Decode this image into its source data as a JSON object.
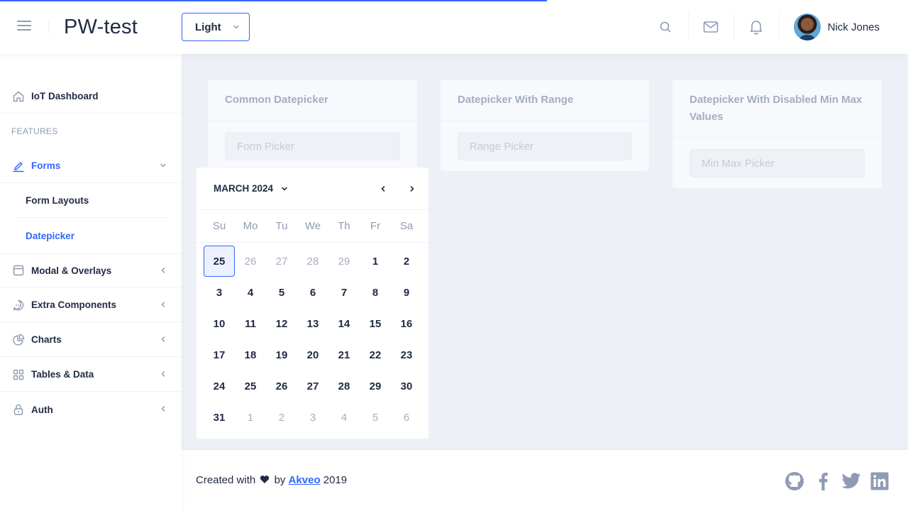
{
  "header": {
    "logo": "PW-test",
    "theme": {
      "selected": "Light"
    },
    "user": {
      "name": "Nick Jones"
    }
  },
  "sidebar": {
    "items": [
      {
        "label": "IoT Dashboard",
        "icon": "home-icon"
      },
      {
        "label": "Forms",
        "icon": "edit-icon",
        "expanded": true
      },
      {
        "label": "Modal & Overlays",
        "icon": "browser-icon"
      },
      {
        "label": "Extra Components",
        "icon": "message-circle-icon"
      },
      {
        "label": "Charts",
        "icon": "pie-chart-icon"
      },
      {
        "label": "Tables & Data",
        "icon": "grid-icon"
      },
      {
        "label": "Auth",
        "icon": "lock-icon"
      }
    ],
    "section_title": "FEATURES",
    "forms_children": [
      {
        "label": "Form Layouts"
      },
      {
        "label": "Datepicker",
        "active": true
      }
    ]
  },
  "cards": [
    {
      "title": "Common Datepicker",
      "placeholder": "Form Picker"
    },
    {
      "title": "Datepicker With Range",
      "placeholder": "Range Picker"
    },
    {
      "title": "Datepicker With Disabled Min Max Values",
      "placeholder": "Min Max Picker"
    }
  ],
  "calendar": {
    "title": "MARCH 2024",
    "weekdays": [
      "Su",
      "Mo",
      "Tu",
      "We",
      "Th",
      "Fr",
      "Sa"
    ],
    "weeks": [
      [
        {
          "d": "25",
          "m": 0,
          "sel": 1
        },
        {
          "d": "26",
          "m": 1
        },
        {
          "d": "27",
          "m": 1
        },
        {
          "d": "28",
          "m": 1
        },
        {
          "d": "29",
          "m": 1
        },
        {
          "d": "1"
        },
        {
          "d": "2"
        }
      ],
      [
        {
          "d": "3"
        },
        {
          "d": "4"
        },
        {
          "d": "5"
        },
        {
          "d": "6"
        },
        {
          "d": "7"
        },
        {
          "d": "8"
        },
        {
          "d": "9"
        }
      ],
      [
        {
          "d": "10"
        },
        {
          "d": "11"
        },
        {
          "d": "12"
        },
        {
          "d": "13"
        },
        {
          "d": "14"
        },
        {
          "d": "15"
        },
        {
          "d": "16"
        }
      ],
      [
        {
          "d": "17"
        },
        {
          "d": "18"
        },
        {
          "d": "19"
        },
        {
          "d": "20"
        },
        {
          "d": "21"
        },
        {
          "d": "22"
        },
        {
          "d": "23"
        }
      ],
      [
        {
          "d": "24"
        },
        {
          "d": "25"
        },
        {
          "d": "26"
        },
        {
          "d": "27"
        },
        {
          "d": "28"
        },
        {
          "d": "29"
        },
        {
          "d": "30"
        }
      ],
      [
        {
          "d": "31"
        },
        {
          "d": "1",
          "m": 1
        },
        {
          "d": "2",
          "m": 1
        },
        {
          "d": "3",
          "m": 1
        },
        {
          "d": "4",
          "m": 1
        },
        {
          "d": "5",
          "m": 1
        },
        {
          "d": "6",
          "m": 1
        }
      ]
    ]
  },
  "footer": {
    "prefix": "Created with",
    "by": "by",
    "link": "Akveo",
    "year": "2019"
  },
  "colors": {
    "accent": "#3366ff",
    "text": "#222b45",
    "muted": "#8f9bb3",
    "background": "#edf1f7"
  }
}
